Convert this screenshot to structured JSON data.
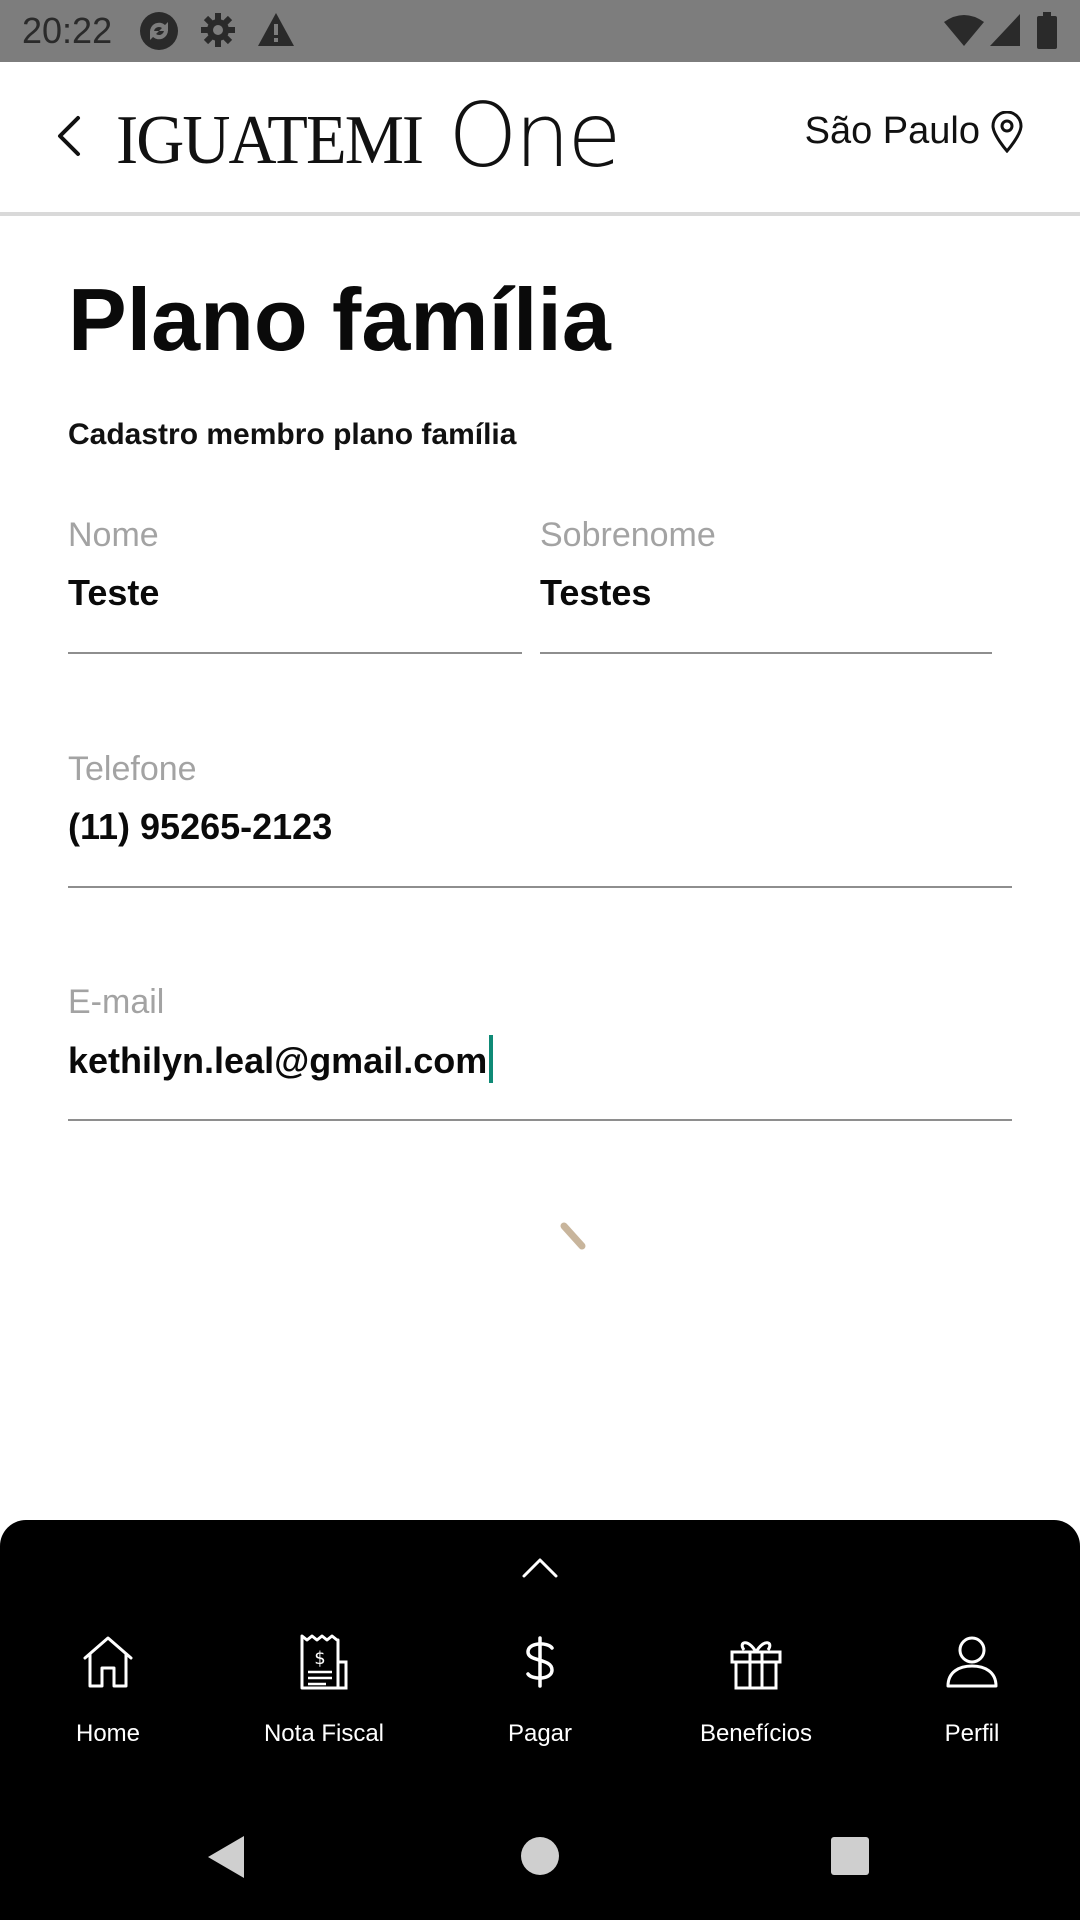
{
  "status_bar": {
    "time": "20:22",
    "left_icons": [
      "sync-icon",
      "gear-icon",
      "warning-icon"
    ],
    "right_icons": [
      "wifi-icon",
      "signal-icon",
      "battery-icon"
    ]
  },
  "header": {
    "logo_main": "IGUATEMI",
    "logo_one": "One",
    "location": "São Paulo"
  },
  "page": {
    "title": "Plano família",
    "subtitle": "Cadastro membro plano família"
  },
  "form": {
    "first_name": {
      "label": "Nome",
      "value": "Teste"
    },
    "last_name": {
      "label": "Sobrenome",
      "value": "Testes"
    },
    "phone": {
      "label": "Telefone",
      "value": "(11) 95265-2123"
    },
    "email": {
      "label": "E-mail",
      "value": "kethilyn.leal@gmail.com"
    }
  },
  "bottom_nav": {
    "items": [
      {
        "label": "Home",
        "icon": "home-icon"
      },
      {
        "label": "Nota Fiscal",
        "icon": "receipt-icon"
      },
      {
        "label": "Pagar",
        "icon": "dollar-icon"
      },
      {
        "label": "Benefícios",
        "icon": "gift-icon"
      },
      {
        "label": "Perfil",
        "icon": "user-icon"
      }
    ]
  },
  "colors": {
    "accent_caret": "#0f8a76",
    "spinner": "#c8b59c",
    "status_bar": "#7d7d7d",
    "nav_background": "#000000"
  }
}
